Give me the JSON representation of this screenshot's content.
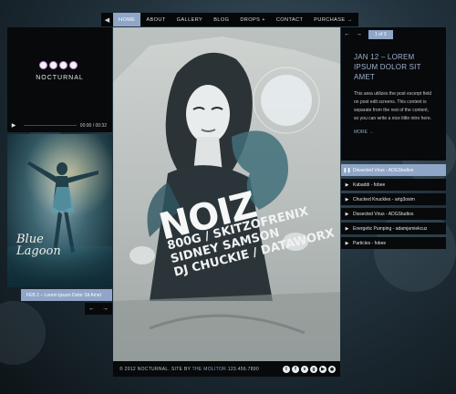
{
  "nav": {
    "prev_icon": "chevron-left",
    "items": [
      {
        "label": "HOME",
        "active": true
      },
      {
        "label": "ABOUT"
      },
      {
        "label": "GALLERY"
      },
      {
        "label": "BLOG"
      },
      {
        "label": "DROPS +"
      },
      {
        "label": "CONTACT"
      },
      {
        "label": "PURCHASE →"
      }
    ]
  },
  "logo": {
    "text": "NOCTURNAL"
  },
  "player": {
    "time": "00:00 / 00:32"
  },
  "poster": {
    "title": "Blue Lagoon"
  },
  "left_post": {
    "caption": "FEB 2 – Lorem Ipsum Dolor Sit Amet"
  },
  "feature": {
    "title": "NOIZ",
    "lines": [
      "800G / SKITZOFRENIX",
      "SIDNEY SAMSON",
      "DJ CHUCKIE / DATAWORX"
    ]
  },
  "footer": {
    "text": "© 2012 NOCTURNAL. SITE BY",
    "link": "THE MOLITOR",
    "phone": "123.456.7890",
    "social": [
      "t",
      "f",
      "v",
      "g",
      "yt",
      "rss"
    ]
  },
  "right_panel": {
    "pager": "1 of 3",
    "post_title": "JAN 12 – LOREM IPSUM DOLOR SIT AMET",
    "post_body": "This area utilizes the post excerpt field on post edit screens. This content is separate from the rest of the content, so you can write a nice little intro here.",
    "more": "MORE →"
  },
  "playlist": [
    {
      "title": "Dissected Virus - ADGStudios",
      "active": true
    },
    {
      "title": "Kabaddi - fobee"
    },
    {
      "title": "Chucked Knuckles - artg3osim"
    },
    {
      "title": "Dissected Virus - ADGStudios"
    },
    {
      "title": "Energetic Pumping - adamjamiekcuz"
    },
    {
      "title": "Particles - fobee"
    }
  ],
  "colors": {
    "accent": "#8fa6c8",
    "panel": "#07090b",
    "title": "#9fb2d0"
  }
}
